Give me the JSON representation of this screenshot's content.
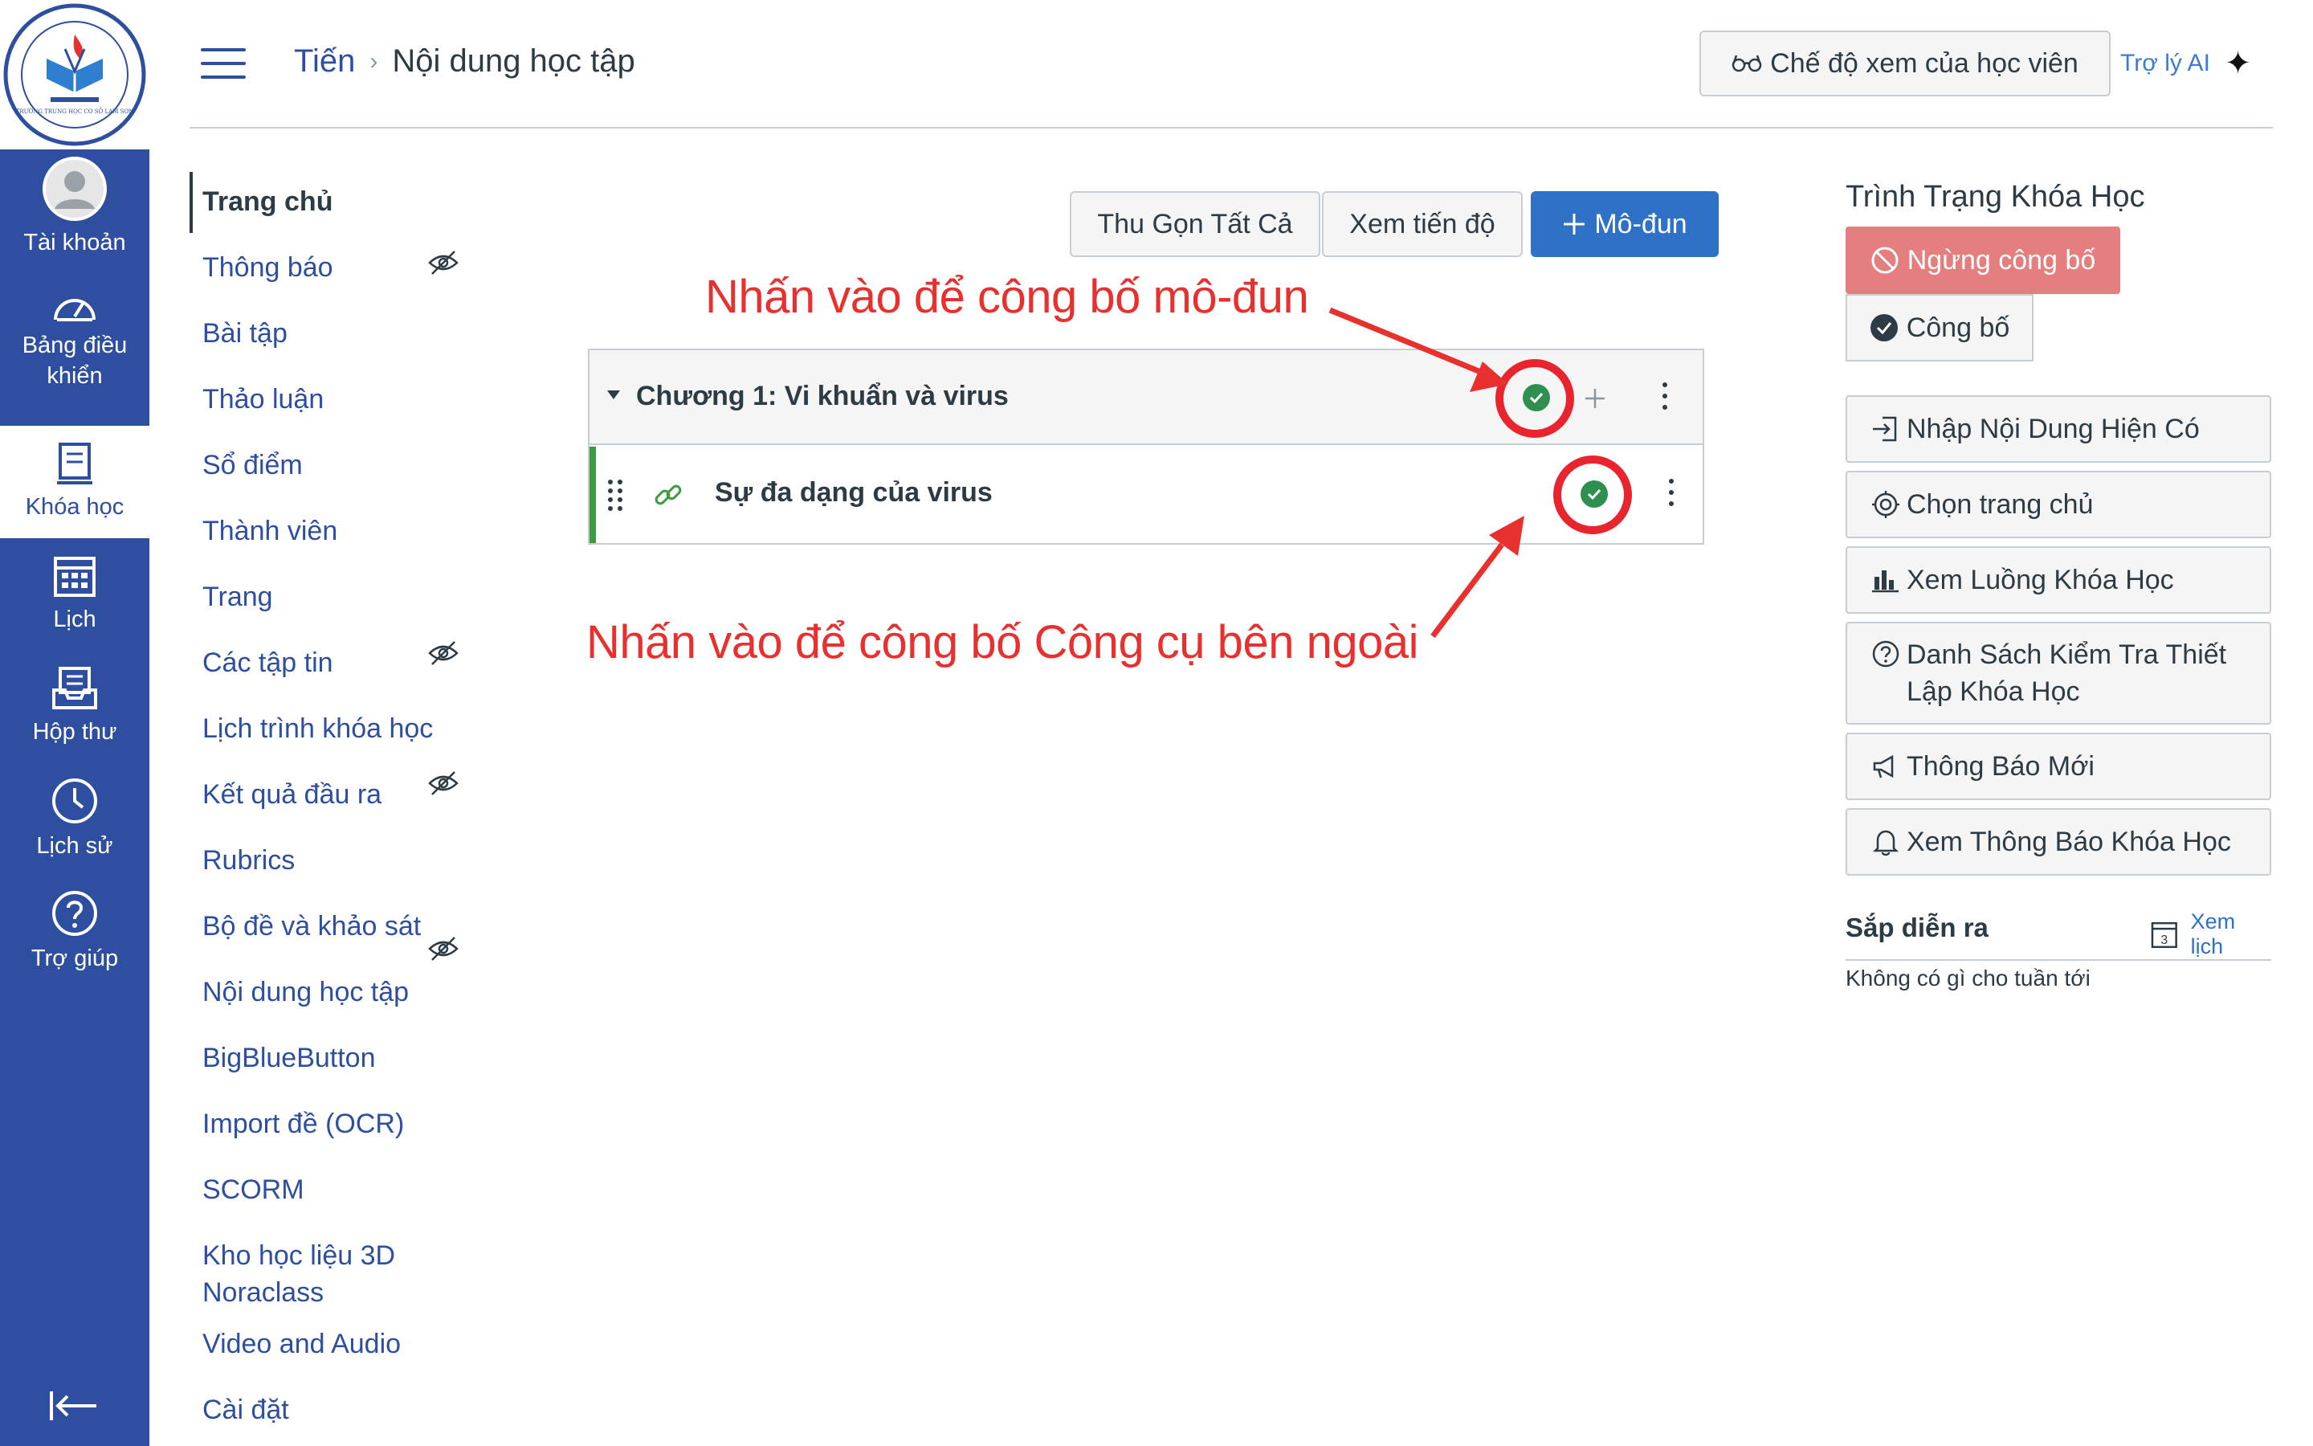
{
  "global_nav": {
    "logo_text": "TRƯỜNG TRUNG HỌC CƠ SỞ LAM SƠN",
    "items": [
      {
        "label": "Tài khoản",
        "icon": "avatar-icon"
      },
      {
        "label": "Bảng điều khiển",
        "icon": "dashboard-icon"
      },
      {
        "label": "Khóa học",
        "icon": "courses-icon"
      },
      {
        "label": "Lịch",
        "icon": "calendar-icon"
      },
      {
        "label": "Hộp thư",
        "icon": "inbox-icon"
      },
      {
        "label": "Lịch sử",
        "icon": "history-icon"
      },
      {
        "label": "Trợ giúp",
        "icon": "help-icon"
      }
    ]
  },
  "header": {
    "course": "Tiến",
    "separator": "›",
    "page": "Nội dung học tập",
    "student_view": "Chế độ xem của học viên",
    "ai": "Trợ lý AI",
    "ai_icon": "✦"
  },
  "course_nav": {
    "items": [
      {
        "label": "Trang chủ"
      },
      {
        "label": "Thông báo"
      },
      {
        "label": "Bài tập"
      },
      {
        "label": "Thảo luận"
      },
      {
        "label": "Sổ điểm"
      },
      {
        "label": "Thành viên"
      },
      {
        "label": "Trang"
      },
      {
        "label": "Các tập tin"
      },
      {
        "label": "Lịch trình khóa học"
      },
      {
        "label": "Kết quả đầu ra"
      },
      {
        "label": "Rubrics"
      },
      {
        "label": "Bộ đề và khảo sát"
      },
      {
        "label": "Nội dung học tập"
      },
      {
        "label": "BigBlueButton"
      },
      {
        "label": "Import đề (OCR)"
      },
      {
        "label": "SCORM"
      },
      {
        "label": "Kho học liệu 3D Noraclass"
      },
      {
        "label": "Video and Audio"
      },
      {
        "label": "Cài đặt"
      }
    ]
  },
  "main": {
    "collapse_all": "Thu Gọn Tất Cả",
    "view_progress": "Xem tiến độ",
    "add_module": "Mô-đun",
    "module_title": "Chương 1: Vi khuẩn và virus",
    "item_title": "Sự đa dạng của virus",
    "annotation_module": "Nhấn vào để công bố mô-đun",
    "annotation_tool": "Nhấn vào để công bố Công cụ bên ngoài"
  },
  "sidebar": {
    "status_title": "Trình Trạng Khóa Học",
    "unpublish": "Ngừng công bố",
    "publish": "Công bố",
    "buttons": [
      {
        "label": "Nhập Nội Dung Hiện Có",
        "icon": "import-icon"
      },
      {
        "label": "Chọn trang chủ",
        "icon": "target-icon"
      },
      {
        "label": "Xem Luồng Khóa Học",
        "icon": "stream-icon"
      },
      {
        "label": "Danh Sách Kiểm Tra Thiết Lập Khóa Học",
        "icon": "question-icon"
      },
      {
        "label": "Thông Báo Mới",
        "icon": "megaphone-icon"
      },
      {
        "label": "Xem Thông Báo Khóa Học",
        "icon": "bell-icon"
      }
    ],
    "coming_up_title": "Sắp diễn ra",
    "view_calendar": "Xem lịch",
    "calendar_day": "3",
    "coming_up_empty": "Không có gì cho tuần tới"
  },
  "colors": {
    "nav_bg": "#2e4f9f",
    "link": "#2e4f9f",
    "primary": "#2f71c7",
    "published": "#2f8f4f",
    "annotation": "#e8302f",
    "unpublish_bg": "#e57e7e"
  }
}
